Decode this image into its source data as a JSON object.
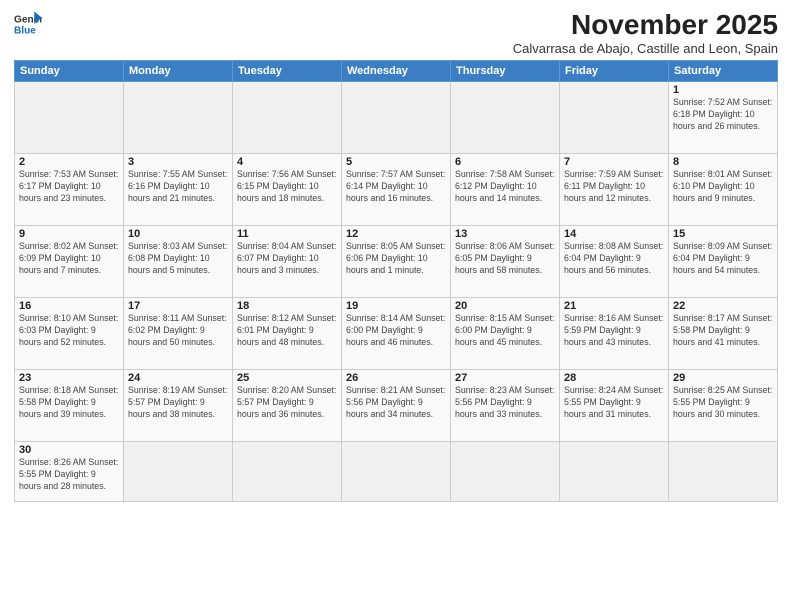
{
  "header": {
    "logo_general": "General",
    "logo_blue": "Blue",
    "month_title": "November 2025",
    "subtitle": "Calvarrasa de Abajo, Castille and Leon, Spain"
  },
  "weekdays": [
    "Sunday",
    "Monday",
    "Tuesday",
    "Wednesday",
    "Thursday",
    "Friday",
    "Saturday"
  ],
  "weeks": [
    [
      {
        "day": "",
        "info": ""
      },
      {
        "day": "",
        "info": ""
      },
      {
        "day": "",
        "info": ""
      },
      {
        "day": "",
        "info": ""
      },
      {
        "day": "",
        "info": ""
      },
      {
        "day": "",
        "info": ""
      },
      {
        "day": "1",
        "info": "Sunrise: 7:52 AM\nSunset: 6:18 PM\nDaylight: 10 hours and 26 minutes."
      }
    ],
    [
      {
        "day": "2",
        "info": "Sunrise: 7:53 AM\nSunset: 6:17 PM\nDaylight: 10 hours and 23 minutes."
      },
      {
        "day": "3",
        "info": "Sunrise: 7:55 AM\nSunset: 6:16 PM\nDaylight: 10 hours and 21 minutes."
      },
      {
        "day": "4",
        "info": "Sunrise: 7:56 AM\nSunset: 6:15 PM\nDaylight: 10 hours and 18 minutes."
      },
      {
        "day": "5",
        "info": "Sunrise: 7:57 AM\nSunset: 6:14 PM\nDaylight: 10 hours and 16 minutes."
      },
      {
        "day": "6",
        "info": "Sunrise: 7:58 AM\nSunset: 6:12 PM\nDaylight: 10 hours and 14 minutes."
      },
      {
        "day": "7",
        "info": "Sunrise: 7:59 AM\nSunset: 6:11 PM\nDaylight: 10 hours and 12 minutes."
      },
      {
        "day": "8",
        "info": "Sunrise: 8:01 AM\nSunset: 6:10 PM\nDaylight: 10 hours and 9 minutes."
      }
    ],
    [
      {
        "day": "9",
        "info": "Sunrise: 8:02 AM\nSunset: 6:09 PM\nDaylight: 10 hours and 7 minutes."
      },
      {
        "day": "10",
        "info": "Sunrise: 8:03 AM\nSunset: 6:08 PM\nDaylight: 10 hours and 5 minutes."
      },
      {
        "day": "11",
        "info": "Sunrise: 8:04 AM\nSunset: 6:07 PM\nDaylight: 10 hours and 3 minutes."
      },
      {
        "day": "12",
        "info": "Sunrise: 8:05 AM\nSunset: 6:06 PM\nDaylight: 10 hours and 1 minute."
      },
      {
        "day": "13",
        "info": "Sunrise: 8:06 AM\nSunset: 6:05 PM\nDaylight: 9 hours and 58 minutes."
      },
      {
        "day": "14",
        "info": "Sunrise: 8:08 AM\nSunset: 6:04 PM\nDaylight: 9 hours and 56 minutes."
      },
      {
        "day": "15",
        "info": "Sunrise: 8:09 AM\nSunset: 6:04 PM\nDaylight: 9 hours and 54 minutes."
      }
    ],
    [
      {
        "day": "16",
        "info": "Sunrise: 8:10 AM\nSunset: 6:03 PM\nDaylight: 9 hours and 52 minutes."
      },
      {
        "day": "17",
        "info": "Sunrise: 8:11 AM\nSunset: 6:02 PM\nDaylight: 9 hours and 50 minutes."
      },
      {
        "day": "18",
        "info": "Sunrise: 8:12 AM\nSunset: 6:01 PM\nDaylight: 9 hours and 48 minutes."
      },
      {
        "day": "19",
        "info": "Sunrise: 8:14 AM\nSunset: 6:00 PM\nDaylight: 9 hours and 46 minutes."
      },
      {
        "day": "20",
        "info": "Sunrise: 8:15 AM\nSunset: 6:00 PM\nDaylight: 9 hours and 45 minutes."
      },
      {
        "day": "21",
        "info": "Sunrise: 8:16 AM\nSunset: 5:59 PM\nDaylight: 9 hours and 43 minutes."
      },
      {
        "day": "22",
        "info": "Sunrise: 8:17 AM\nSunset: 5:58 PM\nDaylight: 9 hours and 41 minutes."
      }
    ],
    [
      {
        "day": "23",
        "info": "Sunrise: 8:18 AM\nSunset: 5:58 PM\nDaylight: 9 hours and 39 minutes."
      },
      {
        "day": "24",
        "info": "Sunrise: 8:19 AM\nSunset: 5:57 PM\nDaylight: 9 hours and 38 minutes."
      },
      {
        "day": "25",
        "info": "Sunrise: 8:20 AM\nSunset: 5:57 PM\nDaylight: 9 hours and 36 minutes."
      },
      {
        "day": "26",
        "info": "Sunrise: 8:21 AM\nSunset: 5:56 PM\nDaylight: 9 hours and 34 minutes."
      },
      {
        "day": "27",
        "info": "Sunrise: 8:23 AM\nSunset: 5:56 PM\nDaylight: 9 hours and 33 minutes."
      },
      {
        "day": "28",
        "info": "Sunrise: 8:24 AM\nSunset: 5:55 PM\nDaylight: 9 hours and 31 minutes."
      },
      {
        "day": "29",
        "info": "Sunrise: 8:25 AM\nSunset: 5:55 PM\nDaylight: 9 hours and 30 minutes."
      }
    ],
    [
      {
        "day": "30",
        "info": "Sunrise: 8:26 AM\nSunset: 5:55 PM\nDaylight: 9 hours and 28 minutes."
      },
      {
        "day": "",
        "info": ""
      },
      {
        "day": "",
        "info": ""
      },
      {
        "day": "",
        "info": ""
      },
      {
        "day": "",
        "info": ""
      },
      {
        "day": "",
        "info": ""
      },
      {
        "day": "",
        "info": ""
      }
    ]
  ]
}
